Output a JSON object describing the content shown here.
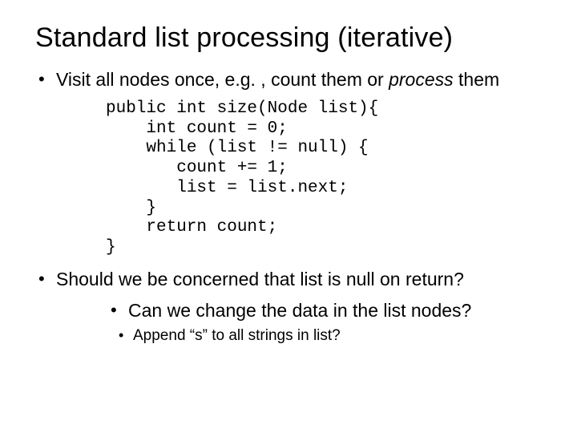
{
  "title": "Standard list processing (iterative)",
  "bullets": {
    "b1_pre": "Visit all nodes once, e.g. , count them or ",
    "b1_em": "process",
    "b1_post": " them",
    "b2": "Should we be concerned that list is null on return?",
    "b3": "Can we change the data in the list nodes?",
    "b4": "Append “s” to all strings in list?"
  },
  "code": {
    "l1": "public int size(Node list){",
    "l2": "    int count = 0;",
    "l3": "    while (list != null) {",
    "l4": "       count += 1;",
    "l5": "       list = list.next;",
    "l6": "    }",
    "l7": "    return count;",
    "l8": "}"
  }
}
